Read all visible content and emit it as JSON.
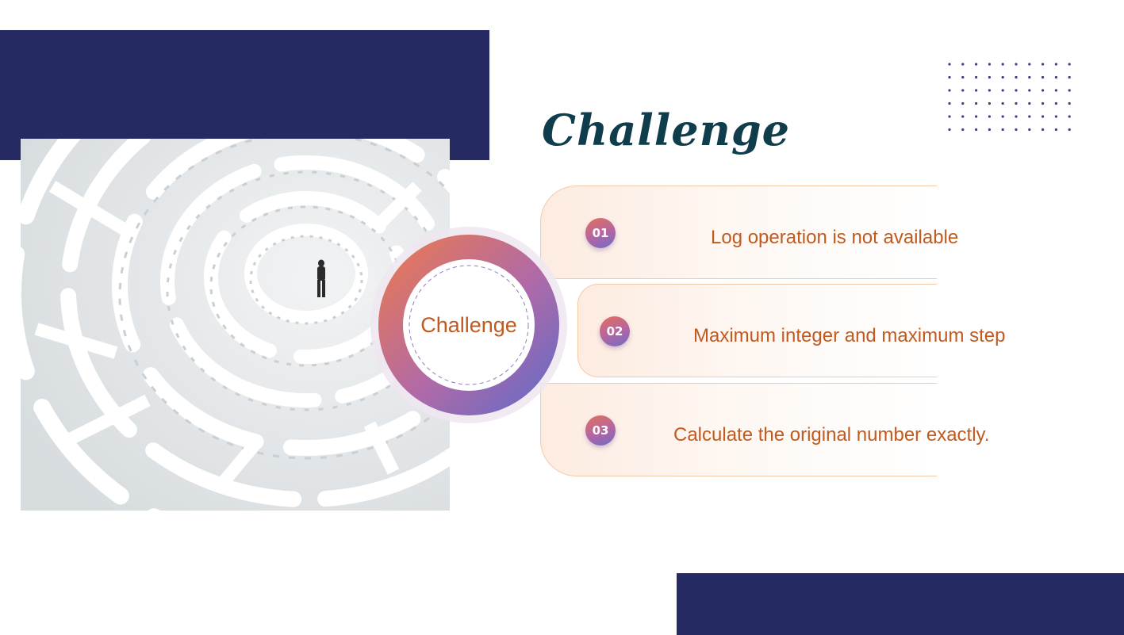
{
  "slide": {
    "title": "Challenge",
    "center_label": "Challenge",
    "colors": {
      "navy": "#262a63",
      "title": "#0f3d4c",
      "accent_text": "#c05a1f",
      "gradient_start": "#e4705a",
      "gradient_end": "#6e6cc6"
    },
    "photo_description_icon": "maze-image",
    "items": [
      {
        "number": "01",
        "text": "Log operation is not available"
      },
      {
        "number": "02",
        "text": "Maximum integer and maximum step"
      },
      {
        "number": "03",
        "text": "Calculate the original number exactly."
      }
    ]
  }
}
